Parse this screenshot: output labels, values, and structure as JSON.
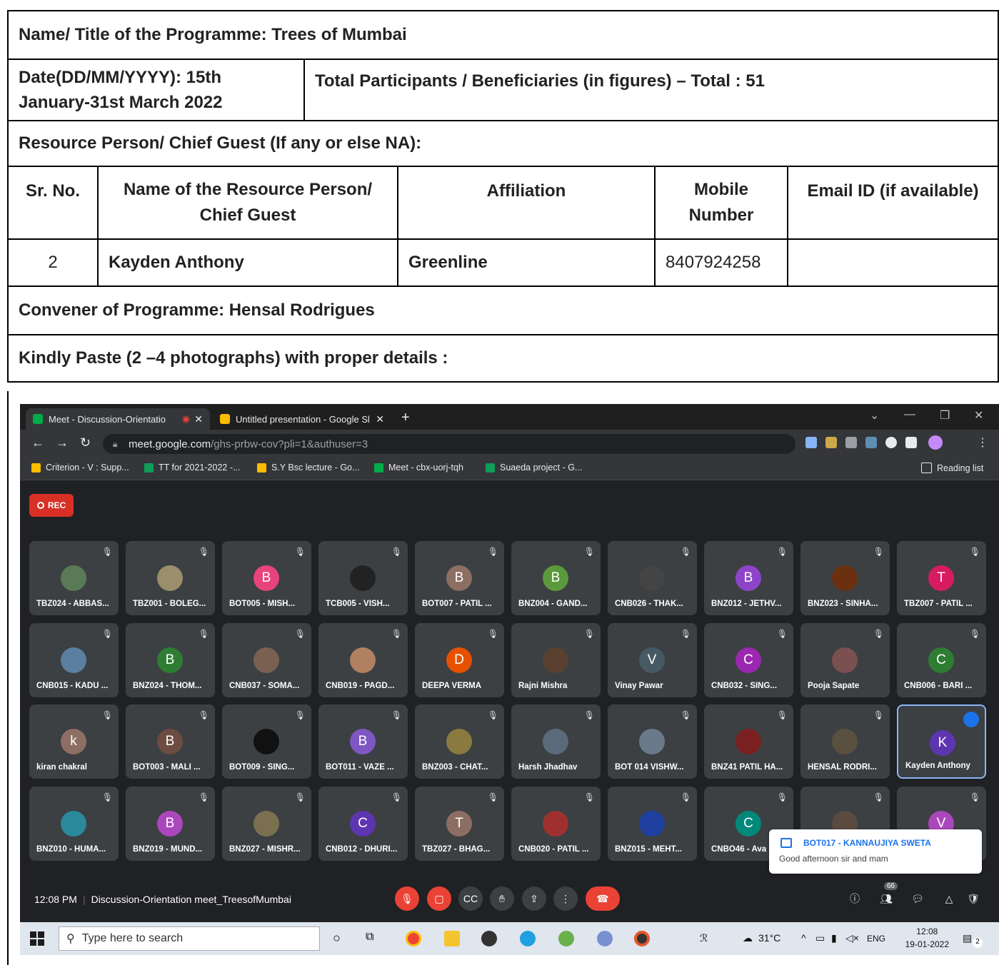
{
  "form": {
    "programme_title": "Name/ Title of the Programme: Trees of Mumbai",
    "date_label": "Date(DD/MM/YYYY): 15th January-31st March 2022",
    "participants_label": "Total Participants / Beneficiaries (in figures) –  Total : 51",
    "resource_label": "Resource Person/ Chief Guest (If any or else NA):",
    "table_headers": [
      "Sr. No.",
      "Name of the Resource Person/ Chief Guest",
      "Affiliation",
      "Mobile Number",
      "Email ID (if available)"
    ],
    "table_rows": [
      [
        "2",
        "Kayden Anthony",
        "Greenline",
        "8407924258",
        ""
      ]
    ],
    "convener_label": "Convener of Programme: Hensal Rodrigues",
    "photos_label": "Kindly Paste (2 –4  photographs) with proper details :"
  },
  "screenshot": {
    "tabs": [
      {
        "title": "Meet - Discussion-Orientatio",
        "icon": "google-meet-icon",
        "color": "#00ac47"
      },
      {
        "title": "Untitled presentation - Google Sl",
        "icon": "google-slides-icon",
        "color": "#fbbc04"
      }
    ],
    "url_host": "meet.google.com",
    "url_path": "/ghs-prbw-cov?pli=1&authuser=3",
    "bookmarks": [
      "Criterion - V : Supp...",
      "TT for 2021-2022 -...",
      "S.Y Bsc lecture - Go...",
      "Meet - cbx-uorj-tqh",
      "Suaeda project - G..."
    ],
    "reading_list": "Reading list",
    "rec_label": "REC",
    "participants": [
      {
        "name": "TBZ024 - ABBAS...",
        "initial": "",
        "color": "#5a7a55"
      },
      {
        "name": "TBZ001 - BOLEG...",
        "initial": "",
        "color": "#9a8f6a"
      },
      {
        "name": "BOT005 - MISH...",
        "initial": "B",
        "color": "#e8437a"
      },
      {
        "name": "TCB005 - VISH...",
        "initial": "",
        "color": "#222222"
      },
      {
        "name": "BOT007 - PATIL ...",
        "initial": "B",
        "color": "#8d6e63"
      },
      {
        "name": "BNZ004 - GAND...",
        "initial": "B",
        "color": "#5b9a3c"
      },
      {
        "name": "CNB026 - THAK...",
        "initial": "",
        "color": "#444444"
      },
      {
        "name": "BNZ012 - JETHV...",
        "initial": "B",
        "color": "#8e44c9"
      },
      {
        "name": "BNZ023 - SINHA...",
        "initial": "",
        "color": "#6a3010"
      },
      {
        "name": "TBZ007 - PATIL ...",
        "initial": "T",
        "color": "#d81b60"
      },
      {
        "name": "CNB015 - KADU ...",
        "initial": "",
        "color": "#5a7fa0"
      },
      {
        "name": "BNZ024 - THOM...",
        "initial": "B",
        "color": "#2e7d32"
      },
      {
        "name": "CNB037 - SOMA...",
        "initial": "",
        "color": "#7a6050"
      },
      {
        "name": "CNB019 - PAGD...",
        "initial": "",
        "color": "#b08060"
      },
      {
        "name": "DEEPA VERMA",
        "initial": "D",
        "color": "#e65100"
      },
      {
        "name": "Rajni Mishra",
        "initial": "",
        "color": "#5a4030"
      },
      {
        "name": "Vinay Pawar",
        "initial": "V",
        "color": "#455a64"
      },
      {
        "name": "CNB032 - SING...",
        "initial": "C",
        "color": "#9c27b0"
      },
      {
        "name": "Pooja Sapate",
        "initial": "",
        "color": "#7a5050"
      },
      {
        "name": "CNB006 - BARI ...",
        "initial": "C",
        "color": "#2e7d32"
      },
      {
        "name": "kiran chakral",
        "initial": "k",
        "color": "#8d6e63"
      },
      {
        "name": "BOT003 - MALI ...",
        "initial": "B",
        "color": "#6d4c41"
      },
      {
        "name": "BOT009 - SING...",
        "initial": "",
        "color": "#111111"
      },
      {
        "name": "BOT011 - VAZE ...",
        "initial": "B",
        "color": "#7e57c2"
      },
      {
        "name": "BNZ003 - CHAT...",
        "initial": "",
        "color": "#8a7a40"
      },
      {
        "name": "Harsh Jhadhav",
        "initial": "",
        "color": "#5a6a7a"
      },
      {
        "name": "BOT 014 VISHW...",
        "initial": "",
        "color": "#6a7a8a"
      },
      {
        "name": "BNZ41 PATIL HA...",
        "initial": "",
        "color": "#7a2020"
      },
      {
        "name": "HENSAL RODRI...",
        "initial": "",
        "color": "#5a5040"
      },
      {
        "name": "Kayden Anthony",
        "initial": "K",
        "color": "#5e35b1"
      },
      {
        "name": "BNZ010 - HUMA...",
        "initial": "",
        "color": "#2a8a9a"
      },
      {
        "name": "BNZ019 - MUND...",
        "initial": "B",
        "color": "#ab47bc"
      },
      {
        "name": "BNZ027 - MISHR...",
        "initial": "",
        "color": "#7a7050"
      },
      {
        "name": "CNB012 - DHURI...",
        "initial": "C",
        "color": "#5e35b1"
      },
      {
        "name": "TBZ027 - BHAG...",
        "initial": "T",
        "color": "#8d6e63"
      },
      {
        "name": "CNB020 - PATIL ...",
        "initial": "",
        "color": "#a03030"
      },
      {
        "name": "BNZ015 - MEHT...",
        "initial": "",
        "color": "#2040a0"
      },
      {
        "name": "CNBO46 - Ava",
        "initial": "C",
        "color": "#00897b"
      },
      {
        "name": "",
        "initial": "",
        "color": "#5a4a40"
      },
      {
        "name": "",
        "initial": "V",
        "color": "#ab47bc"
      }
    ],
    "chat_toast": {
      "sender": "BOT017 - KANNAUJIYA SWETA",
      "message": "Good afternoon sir and mam"
    },
    "meeting_time": "12:08 PM",
    "meeting_name": "Discussion-Orientation meet_TreesofMumbai",
    "people_count": "66",
    "taskbar": {
      "search_placeholder": "Type here to search",
      "weather": "31°C",
      "lang": "ENG",
      "time": "12:08",
      "date": "19-01-2022",
      "notif_count": "2"
    }
  }
}
